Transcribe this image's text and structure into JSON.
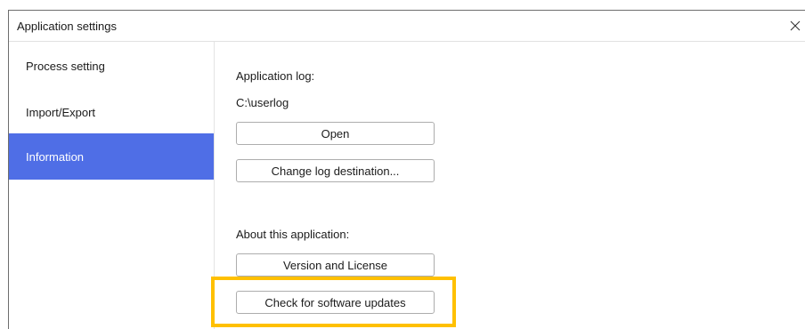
{
  "window": {
    "title": "Application settings",
    "close_icon": "close-icon"
  },
  "sidebar": {
    "items": [
      {
        "label": "Process setting",
        "active": false
      },
      {
        "label": "Import/Export",
        "active": false
      },
      {
        "label": "Information",
        "active": true
      }
    ]
  },
  "content": {
    "application_log_label": "Application log:",
    "log_path": "C:\\userlog",
    "open_button": "Open",
    "change_log_button": "Change log destination...",
    "about_label": "About this application:",
    "version_button": "Version and License",
    "check_updates_button": "Check for software updates"
  },
  "colors": {
    "active_item_bg": "#4f6ee6",
    "highlight_border": "#ffc000"
  }
}
